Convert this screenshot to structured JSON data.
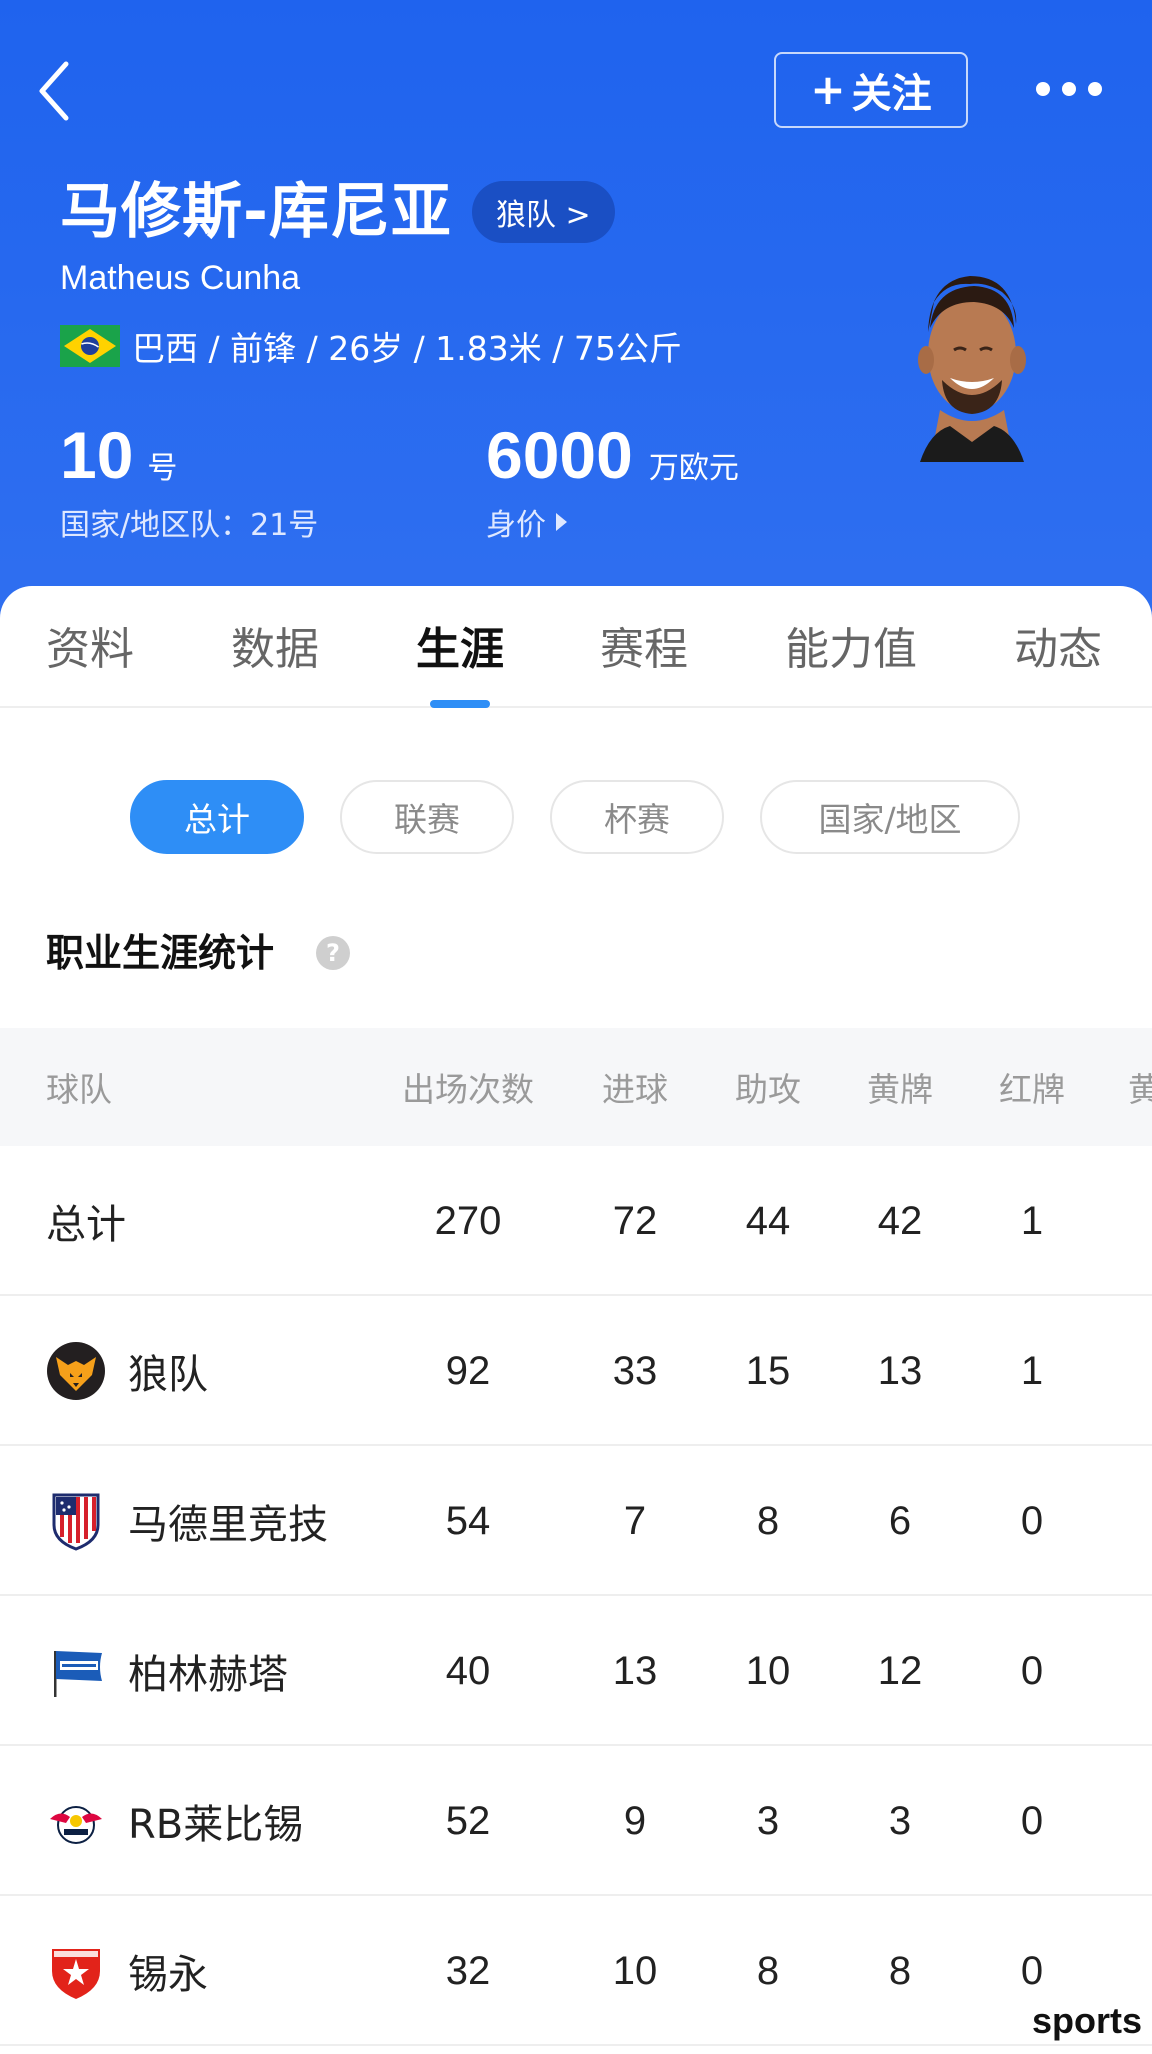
{
  "header": {
    "follow_label": "关注",
    "player_name": "马修斯-库尼亚",
    "team_link": "狼队 >",
    "player_name_en": "Matheus Cunha",
    "info": "巴西 / 前锋 / 26岁 / 1.83米 / 75公斤",
    "flag_icon": "brazil-flag-icon",
    "shirt_number": "10",
    "shirt_unit": "号",
    "national_number": "国家/地区队：21号",
    "market_value": "6000",
    "market_value_unit": "万欧元",
    "market_value_label": "身价"
  },
  "tabs": [
    {
      "label": "资料",
      "active": false
    },
    {
      "label": "数据",
      "active": false
    },
    {
      "label": "生涯",
      "active": true
    },
    {
      "label": "赛程",
      "active": false
    },
    {
      "label": "能力值",
      "active": false
    },
    {
      "label": "动态",
      "active": false
    }
  ],
  "filters": [
    {
      "label": "总计",
      "active": true
    },
    {
      "label": "联赛",
      "active": false
    },
    {
      "label": "杯赛",
      "active": false
    },
    {
      "label": "国家/地区",
      "active": false
    }
  ],
  "section_title": "职业生涯统计",
  "help_icon_text": "?",
  "table": {
    "headers": [
      "球队",
      "出场次数",
      "进球",
      "助攻",
      "黄牌",
      "红牌",
      "黄"
    ],
    "rows": [
      {
        "team": "总计",
        "logo": "",
        "apps": "270",
        "goals": "72",
        "assists": "44",
        "yellow": "42",
        "red": "1"
      },
      {
        "team": "狼队",
        "logo": "wolves-logo-icon",
        "apps": "92",
        "goals": "33",
        "assists": "15",
        "yellow": "13",
        "red": "1"
      },
      {
        "team": "马德里竞技",
        "logo": "atletico-madrid-logo-icon",
        "apps": "54",
        "goals": "7",
        "assists": "8",
        "yellow": "6",
        "red": "0"
      },
      {
        "team": "柏林赫塔",
        "logo": "hertha-bsc-logo-icon",
        "apps": "40",
        "goals": "13",
        "assists": "10",
        "yellow": "12",
        "red": "0"
      },
      {
        "team": "RB莱比锡",
        "logo": "rb-leipzig-logo-icon",
        "apps": "52",
        "goals": "9",
        "assists": "3",
        "yellow": "3",
        "red": "0"
      },
      {
        "team": "锡永",
        "logo": "fc-sion-logo-icon",
        "apps": "32",
        "goals": "10",
        "assists": "8",
        "yellow": "8",
        "red": "0"
      }
    ]
  },
  "watermark": "sports",
  "colors": {
    "header_blue": "#1f63ee",
    "accent_blue": "#2e8ef6"
  }
}
